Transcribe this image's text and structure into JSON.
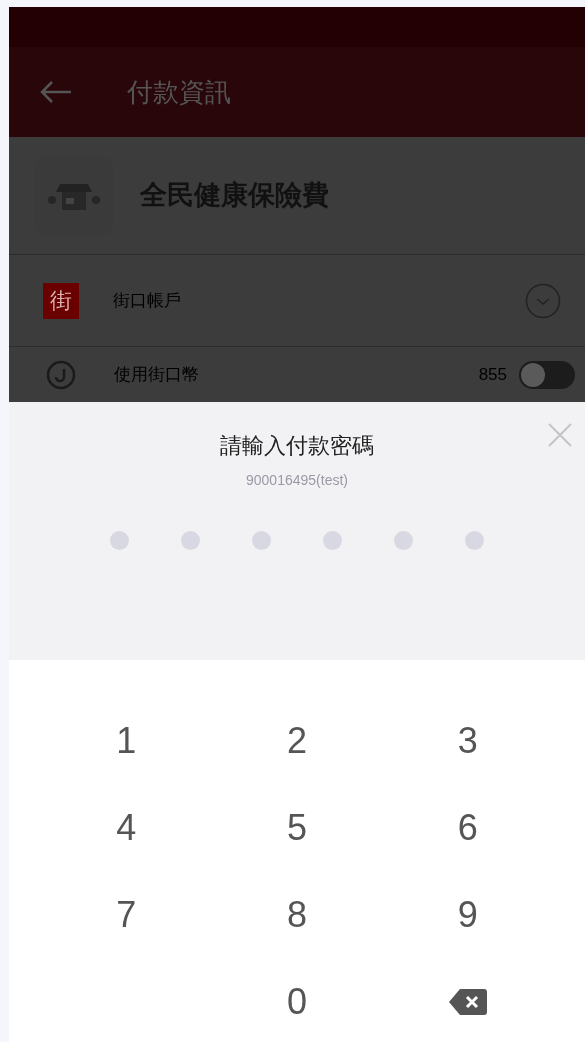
{
  "header": {
    "title": "付款資訊"
  },
  "merchant": {
    "name": "全民健康保險費"
  },
  "payment_rows": [
    {
      "kind": "account",
      "label": "街口帳戶",
      "badge": "街"
    },
    {
      "kind": "coins",
      "label": "使用街口幣",
      "value": "855",
      "on": false
    }
  ],
  "dialog": {
    "title": "請輸入付款密碼",
    "subtitle": "900016495(test)",
    "pin_dots": [
      {
        "filled": false
      },
      {
        "filled": false
      },
      {
        "filled": false
      },
      {
        "filled": false
      },
      {
        "filled": false
      },
      {
        "filled": false
      }
    ]
  },
  "keypad": [
    {
      "kind": "digit",
      "label": "1"
    },
    {
      "kind": "digit",
      "label": "2"
    },
    {
      "kind": "digit",
      "label": "3"
    },
    {
      "kind": "digit",
      "label": "4"
    },
    {
      "kind": "digit",
      "label": "5"
    },
    {
      "kind": "digit",
      "label": "6"
    },
    {
      "kind": "digit",
      "label": "7"
    },
    {
      "kind": "digit",
      "label": "8"
    },
    {
      "kind": "digit",
      "label": "9"
    },
    {
      "kind": "empty"
    },
    {
      "kind": "digit",
      "label": "0"
    },
    {
      "kind": "backspace"
    }
  ]
}
